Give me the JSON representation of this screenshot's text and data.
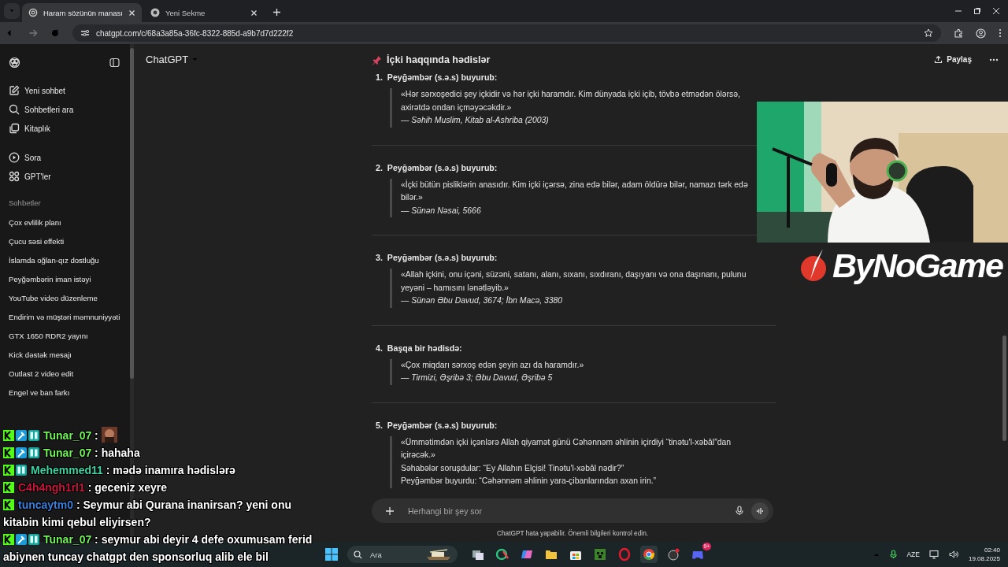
{
  "browser": {
    "tabs": [
      {
        "title": "Haram sözünün manası",
        "selected": true
      },
      {
        "title": "Yeni Sekme",
        "selected": false
      }
    ],
    "url": "chatgpt.com/c/68a3a85a-36fc-8322-885d-a9b7d7d222f2"
  },
  "sidebar": {
    "nav": [
      "Yeni sohbet",
      "Sohbetleri ara",
      "Kitaplık"
    ],
    "apps": [
      "Sora",
      "GPT'ler"
    ],
    "section_title": "Sohbetler",
    "chats": [
      "Çox evlilik planı",
      "Çucu səsi effekti",
      "İslamda oğlan-qız dostluğu",
      "Peyğəmbərin iman istəyi",
      "YouTube video düzenleme",
      "Endirim və müştəri məmnuniyyəti",
      "GTX 1650 RDR2 yayını",
      "Kick dəstək mesajı",
      "Outlast 2 video edit",
      "Engel ve ban farkı"
    ]
  },
  "header": {
    "model": "ChatGPT",
    "share": "Paylaş"
  },
  "article": {
    "title": "İçki haqqında hədislər",
    "items": [
      {
        "number": "1.",
        "heading": "Peyğəmbər (s.ə.s) buyurub:",
        "lines": [
          {
            "kind": "quote",
            "text": "«Hər sərxoşedici şey içkidir və hər içki haramdır. Kim dünyada içki içib, tövbə etmədən ölərsə, axirətdə ondan içməyəcəkdir.»"
          },
          {
            "kind": "source",
            "text": "— Səhih Muslim, Kitab al-Ashriba (2003)"
          }
        ]
      },
      {
        "number": "2.",
        "heading": "Peyğəmbər (s.ə.s) buyurub:",
        "lines": [
          {
            "kind": "quote",
            "text": "«İçki bütün pisliklərin anasıdır. Kim içki içərsə, zina edə bilər, adam öldürə bilər, namazı tərk edə bilər.»"
          },
          {
            "kind": "source",
            "text": "— Sünən Nəsai, 5666"
          }
        ]
      },
      {
        "number": "3.",
        "heading": "Peyğəmbər (s.ə.s) buyurub:",
        "lines": [
          {
            "kind": "quote",
            "text": "«Allah içkini, onu içəni, süzəni, satanı, alanı, sıxanı, sıxdıranı, daşıyanı və ona daşınanı, pulunu yeyəni – hamısını lənətləyib.»"
          },
          {
            "kind": "source",
            "text": "— Sünən Əbu Davud, 3674; İbn Macə, 3380"
          }
        ]
      },
      {
        "number": "4.",
        "heading": "Başqa bir hədisdə:",
        "lines": [
          {
            "kind": "quote",
            "text": "«Çox miqdarı sərxoş edən şeyin azı da haramdır.»"
          },
          {
            "kind": "source",
            "text": "— Tirmizi, Əşribə 3; Əbu Davud, Əşribə 5"
          }
        ]
      },
      {
        "number": "5.",
        "heading": "Peyğəmbər (s.ə.s) buyurub:",
        "lines": [
          {
            "kind": "quote",
            "text": "«Ümmətimdən içki içənlərə Allah qiyamət günü Cəhənnəm əhlinin içirdiyi “tinətu'l-xəbâl”dan içirəcək.»"
          },
          {
            "kind": "quote",
            "text": "Səhabələr soruşdular: “Ey Allahın Elçisi! Tinətu'l-xəbâl nədir?”"
          },
          {
            "kind": "quote",
            "text": "Peyğəmbər buyurdu: “Cəhənnəm əhlinin yara-çibanlarından axan irin.”"
          }
        ]
      }
    ]
  },
  "composer": {
    "placeholder": "Herhangi bir şey sor",
    "disclaimer": "ChatGPT hata yapabilir. Önemli bilgileri kontrol edin."
  },
  "stream": {
    "logo_text": "ByNoGame",
    "chat": [
      {
        "kind": "emote",
        "user": "Tunar_07",
        "separator": ":",
        "color": "#72f25a",
        "badges": [
          {
            "kind": "kick"
          },
          {
            "kind": "hammer"
          },
          {
            "kind": "bars"
          }
        ]
      },
      {
        "kind": "text",
        "user": "Tunar_07",
        "separator": ":",
        "color": "#72f25a",
        "badges": [
          {
            "kind": "kick"
          },
          {
            "kind": "hammer"
          },
          {
            "kind": "bars"
          }
        ],
        "text": "hahaha"
      },
      {
        "kind": "text",
        "user": "Mehemmed11",
        "separator": ":",
        "color": "#3fd3a3",
        "badges": [
          {
            "kind": "kick"
          },
          {
            "kind": "bars"
          }
        ],
        "text": "mədə inamıra hədislərə"
      },
      {
        "kind": "text",
        "user": "C4h4ngh1rl1",
        "separator": ":",
        "color": "#c8163c",
        "badges": [
          {
            "kind": "kick"
          }
        ],
        "text": "geceniz xeyre"
      },
      {
        "kind": "text",
        "user": "tuncaytm0",
        "separator": ":",
        "color": "#3a7fdc",
        "badges": [
          {
            "kind": "kick"
          }
        ],
        "text": "Seymur abi Qurana inanirsan? yeni onu kitabin kimi qebul eliyirsen?"
      },
      {
        "kind": "text",
        "user": "Tunar_07",
        "separator": ":",
        "color": "#72f25a",
        "badges": [
          {
            "kind": "kick"
          },
          {
            "kind": "hammer"
          },
          {
            "kind": "bars"
          }
        ],
        "text": "seymur abi deyir 4 defe oxumusam ferid abiynen tuncay chatgpt den sponsorluq alib ele bil"
      }
    ]
  },
  "taskbar": {
    "search": {
      "placeholder": "Ara"
    },
    "badge": "9+",
    "language": "AZE",
    "time": "02:40",
    "date": "19.08.2025"
  }
}
